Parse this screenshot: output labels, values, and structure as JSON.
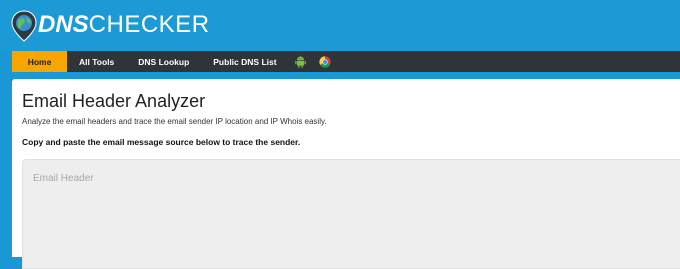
{
  "brand": {
    "dns": "DNS",
    "checker": "CHECKER"
  },
  "nav": {
    "home": "Home",
    "all_tools": "All Tools",
    "dns_lookup": "DNS Lookup",
    "public_dns_list": "Public DNS List",
    "icons": [
      "android-icon",
      "chrome-icon"
    ]
  },
  "main": {
    "title": "Email Header Analyzer",
    "subtitle": "Analyze the email headers and trace the email sender IP location and IP Whois easily.",
    "instruction": "Copy and paste the email message source below to trace the sender.",
    "textarea_placeholder": "Email Header"
  },
  "colors": {
    "header_bg": "#1b9ad6",
    "nav_bg": "#2f3439",
    "nav_active": "#f7a600"
  }
}
